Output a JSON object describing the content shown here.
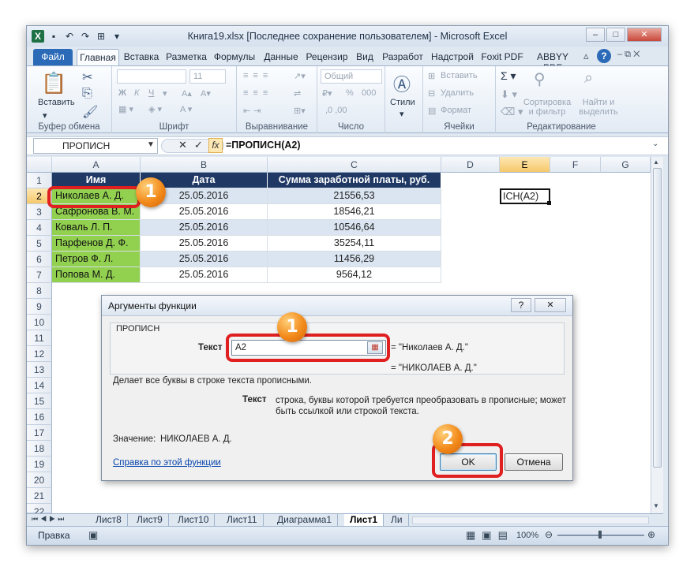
{
  "window": {
    "title": "Книга19.xlsx [Последнее сохранение пользователем]  -  Microsoft Excel",
    "controls": [
      "–",
      "□",
      "✕"
    ]
  },
  "ribbon_tabs": [
    "Файл",
    "Главная",
    "Вставка",
    "Разметка",
    "Формулы",
    "Данные",
    "Рецензир",
    "Вид",
    "Разработ",
    "Надстрой",
    "Foxit PDF",
    "ABBYY PDF"
  ],
  "ribbon": {
    "clipboard": {
      "paste": "Вставить",
      "label": "Буфер обмена"
    },
    "font": {
      "size": "11",
      "label": "Шрифт",
      "bold": "Ж",
      "italic": "К",
      "underline": "Ч"
    },
    "alignment": {
      "label": "Выравнивание"
    },
    "number": {
      "format": "Общий",
      "label": "Число",
      "percent": "%",
      "thousands": "000"
    },
    "styles": {
      "label": "Стили"
    },
    "cells": {
      "insert": "Вставить",
      "delete": "Удалить",
      "format": "Формат",
      "label": "Ячейки"
    },
    "editing": {
      "sort": "Сортировка и фильтр",
      "find": "Найти и выделить",
      "label": "Редактирование"
    }
  },
  "formula_bar": {
    "name_box": "ПРОПИСН",
    "formula": "=ПРОПИСН(A2)"
  },
  "columns": [
    "A",
    "B",
    "C",
    "D",
    "E",
    "F",
    "G"
  ],
  "rows": [
    "1",
    "2",
    "3",
    "4",
    "5",
    "6",
    "7",
    "8",
    "9",
    "10",
    "11",
    "12",
    "13",
    "14",
    "15",
    "16",
    "17",
    "18",
    "19",
    "20",
    "21",
    "22"
  ],
  "table": {
    "headers": [
      "Имя",
      "Дата",
      "Сумма заработной платы, руб."
    ],
    "rows": [
      [
        "Николаев А. Д.",
        "25.05.2016",
        "21556,53"
      ],
      [
        "Сафронова В. М.",
        "25.05.2016",
        "18546,21"
      ],
      [
        "Коваль Л. П.",
        "25.05.2016",
        "10546,64"
      ],
      [
        "Парфенов Д. Ф.",
        "25.05.2016",
        "35254,11"
      ],
      [
        "Петров Ф. Л.",
        "25.05.2016",
        "11456,29"
      ],
      [
        "Попова М. Д.",
        "25.05.2016",
        "9564,12"
      ]
    ]
  },
  "e2_cell": "ICH(A2)",
  "dialog": {
    "title": "Аргументы функции",
    "function_name": "ПРОПИСН",
    "arg_label": "Текст",
    "arg_value": "A2",
    "arg_result": "= \"Николаев А. Д.\"",
    "result": "= \"НИКОЛАЕВ А. Д.\"",
    "description": "Делает все буквы в строке текста прописными.",
    "param_name": "Текст",
    "param_desc": "строка, буквы которой требуется преобразовать в прописные; может быть ссылкой или строкой текста.",
    "value_label": "Значение:",
    "value": "НИКОЛАЕВ А. Д.",
    "help_link": "Справка по этой функции",
    "ok": "OK",
    "cancel": "Отмена",
    "help": "?",
    "close": "✕"
  },
  "sheets": [
    "Лист8",
    "Лист9",
    "Лист10",
    "Лист11",
    "Диаграмма1",
    "Лист1",
    "Ли"
  ],
  "status": {
    "mode": "Правка",
    "zoom": "100%"
  },
  "badges": [
    "1",
    "1",
    "2"
  ]
}
